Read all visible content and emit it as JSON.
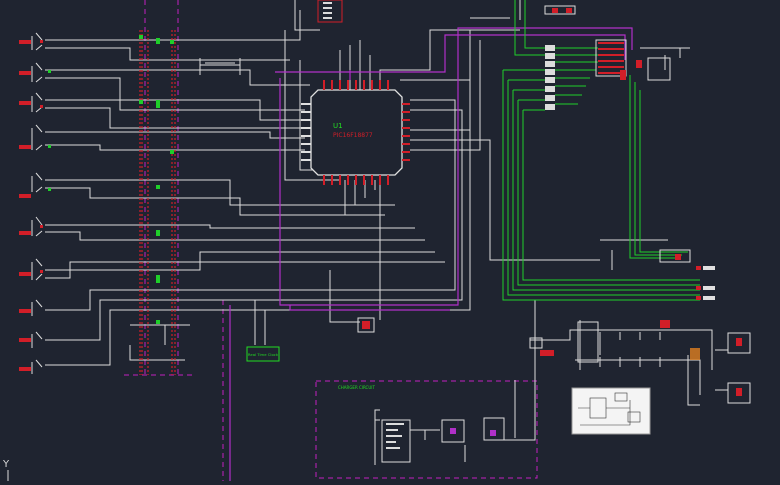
{
  "colors": {
    "background": "#1f2430",
    "wire": "#dcdcdc",
    "bus_green": "#1fcf2a",
    "bus_purple": "#b030c8",
    "component_red": "#d21e28",
    "boundary_magenta": "#c020c0",
    "label_green": "#22dd22",
    "chip_outline": "#e0e0e0"
  },
  "schematic": {
    "mcu": {
      "ref": "U1",
      "part": "PIC16F18877"
    },
    "block_label": "Real Time Clock",
    "region_label": "CHARGER CIRCUIT",
    "ucs_icon": "Y",
    "inset_icon": "board-layout-thumbnail-icon"
  }
}
